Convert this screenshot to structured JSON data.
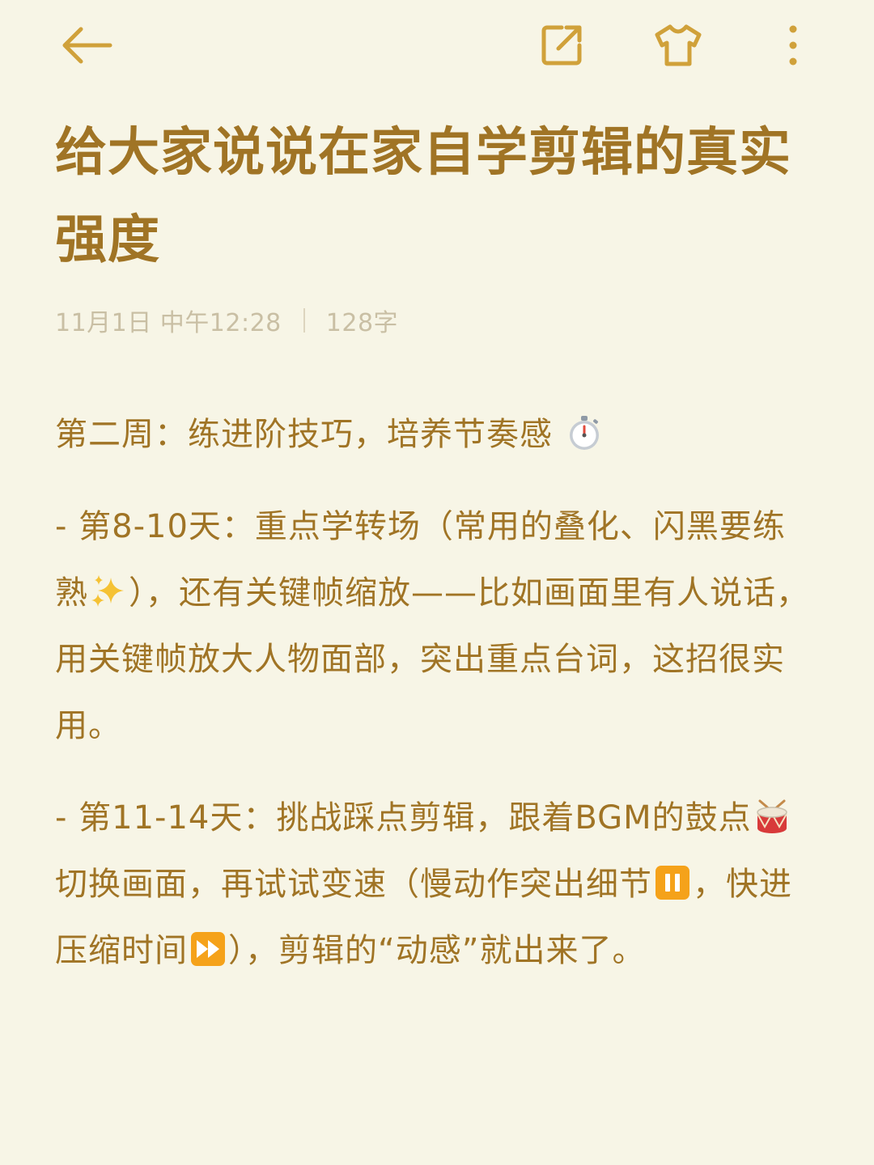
{
  "header": {
    "back_icon": "back-arrow-icon",
    "share_icon": "share-icon",
    "theme_icon": "tshirt-icon",
    "more_icon": "more-vertical-icon"
  },
  "note": {
    "title": "给大家说说在家自学剪辑的真实强度",
    "date": "11月1日 中午12:28",
    "word_count": "128字",
    "body": {
      "heading_text": "第二周：练进阶技巧，培养节奏感",
      "heading_emoji": "stopwatch-icon",
      "p1_a": "- 第8-10天：重点学转场（常用的叠化、闪黑要练熟",
      "p1_emoji": "sparkles-icon",
      "p1_b": "），还有关键帧缩放——比如画面里有人说话，用关键帧放大人物面部，突出重点台词，这招很实用。",
      "p2_a": "- 第11-14天：挑战踩点剪辑，跟着BGM的鼓点",
      "p2_emoji1": "drum-icon",
      "p2_b": "切换画面，再试试变速（慢动作突出细节",
      "p2_emoji2": "pause-icon",
      "p2_c": "，快进压缩时间",
      "p2_emoji3": "fast-forward-icon",
      "p2_d": "），剪辑的“动感”就出来了。"
    }
  },
  "colors": {
    "background": "#f7f5e6",
    "accent": "#a07425",
    "icon": "#d0a13a",
    "meta": "#c9bfa4"
  }
}
